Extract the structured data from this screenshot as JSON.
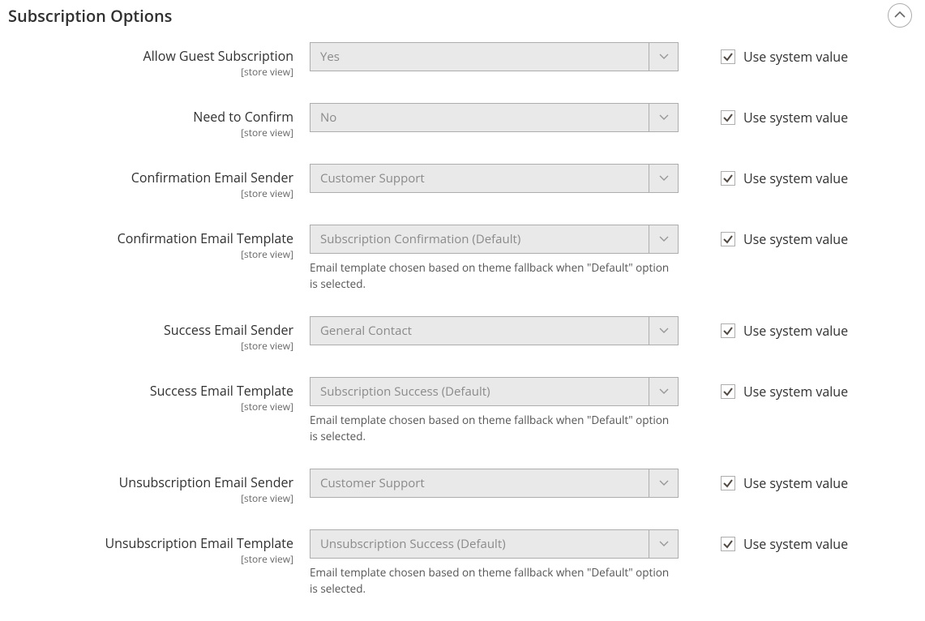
{
  "section_title": "Subscription Options",
  "scope_text": "[store view]",
  "use_system_label": "Use system value",
  "template_note": "Email template chosen based on theme fallback when \"Default\" option is selected.",
  "fields": {
    "allow_guest": {
      "label": "Allow Guest Subscription",
      "value": "Yes"
    },
    "need_confirm": {
      "label": "Need to Confirm",
      "value": "No"
    },
    "conf_sender": {
      "label": "Confirmation Email Sender",
      "value": "Customer Support"
    },
    "conf_template": {
      "label": "Confirmation Email Template",
      "value": "Subscription Confirmation (Default)"
    },
    "succ_sender": {
      "label": "Success Email Sender",
      "value": "General Contact"
    },
    "succ_template": {
      "label": "Success Email Template",
      "value": "Subscription Success (Default)"
    },
    "unsub_sender": {
      "label": "Unsubscription Email Sender",
      "value": "Customer Support"
    },
    "unsub_template": {
      "label": "Unsubscription Email Template",
      "value": "Unsubscription Success (Default)"
    }
  }
}
